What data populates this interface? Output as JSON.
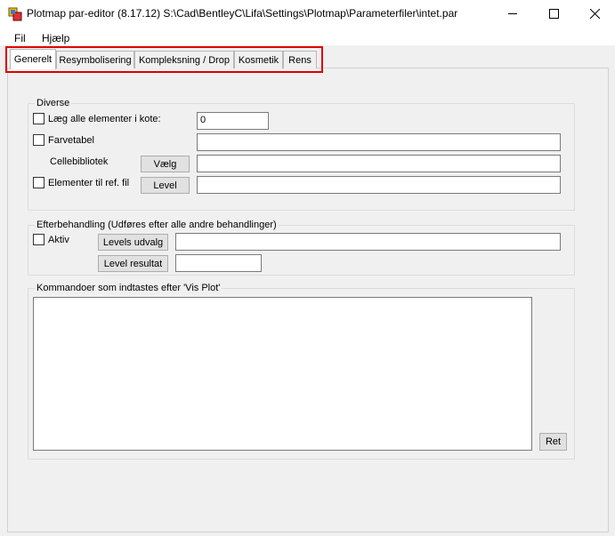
{
  "window": {
    "title": "Plotmap par-editor (8.17.12) S:\\Cad\\BentleyC\\Lifa\\Settings\\Plotmap\\Parameterfiler\\intet.par"
  },
  "menu": [
    "Fil",
    "Hjælp"
  ],
  "tabs": [
    {
      "label": "Generelt",
      "active": true
    },
    {
      "label": "Resymbolisering",
      "active": false
    },
    {
      "label": "Kompleksning / Drop",
      "active": false
    },
    {
      "label": "Kosmetik",
      "active": false
    },
    {
      "label": "Rens",
      "active": false
    }
  ],
  "diverse": {
    "title": "Diverse",
    "laeg_label": "Læg alle elementer i kote:",
    "laeg_value": "0",
    "farvetabel_label": "Farvetabel",
    "farvetabel_value": "",
    "cellebibliotek_label": "Cellebibliotek",
    "vaelg_button": "Vælg",
    "cellebibliotek_value": "",
    "elementer_label": "Elementer til ref. fil",
    "level_button": "Level",
    "elementer_value": ""
  },
  "efterbehandling": {
    "title": "Efterbehandling (Udføres efter alle andre behandlinger)",
    "aktiv_label": "Aktiv",
    "levels_udvalg_button": "Levels udvalg",
    "levels_udvalg_value": "",
    "level_resultat_button": "Level resultat",
    "level_resultat_value": ""
  },
  "kommandoer": {
    "title": "Kommandoer som indtastes efter 'Vis Plot'",
    "text": "",
    "ret_button": "Ret"
  },
  "colors": {
    "highlight": "#e00000",
    "window_bg": "#f0f0f0"
  }
}
